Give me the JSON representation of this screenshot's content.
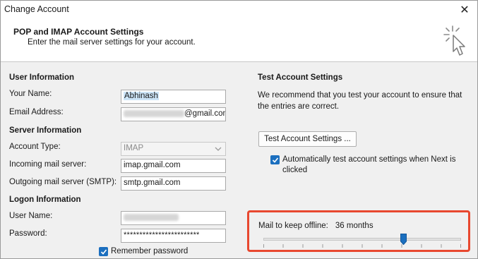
{
  "window": {
    "title": "Change Account",
    "close_glyph": "✕"
  },
  "header": {
    "title": "POP and IMAP Account Settings",
    "subtitle": "Enter the mail server settings for your account.",
    "icon": "cursor-click-icon"
  },
  "user_info": {
    "heading": "User Information",
    "name_label": "Your Name:",
    "name_value": "Abhinash",
    "email_label": "Email Address:",
    "email_suffix": "@gmail.com"
  },
  "server_info": {
    "heading": "Server Information",
    "account_type_label": "Account Type:",
    "account_type_value": "IMAP",
    "incoming_label": "Incoming mail server:",
    "incoming_value": "imap.gmail.com",
    "outgoing_label": "Outgoing mail server (SMTP):",
    "outgoing_value": "smtp.gmail.com"
  },
  "logon_info": {
    "heading": "Logon Information",
    "username_label": "User Name:",
    "password_label": "Password:",
    "password_value": "************************",
    "remember_label": "Remember password",
    "remember_checked": true
  },
  "test_settings": {
    "heading": "Test Account Settings",
    "description": "We recommend that you test your account to ensure that the entries are correct.",
    "button_label": "Test Account Settings ...",
    "auto_test_label": "Automatically test account settings when Next is clicked",
    "auto_test_checked": true
  },
  "offline": {
    "label": "Mail to keep offline:",
    "value": "36 months",
    "slider_fraction": 0.71
  },
  "colors": {
    "accent": "#1b6fbf",
    "highlight_box": "#e8482f"
  }
}
